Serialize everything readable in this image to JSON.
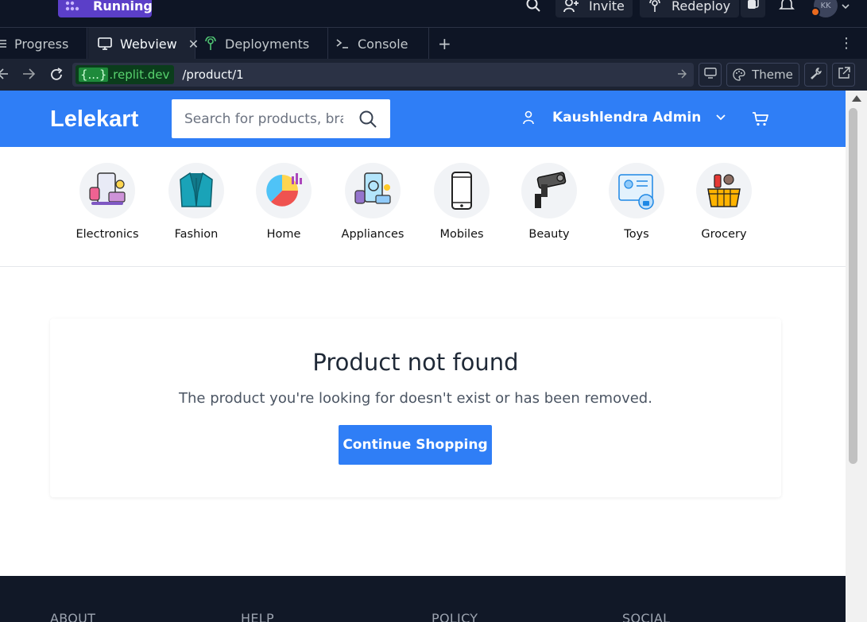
{
  "replit": {
    "run_status": "Running",
    "invite_label": "Invite",
    "redeploy_label": "Redeploy",
    "avatar_initials": "KK",
    "tabs": [
      {
        "label": "Progress"
      },
      {
        "label": "Webview"
      },
      {
        "label": "Deployments"
      },
      {
        "label": "Console"
      }
    ],
    "url": {
      "domain_brace": "{...}",
      "domain_suffix": ".replit.dev",
      "path": "/product/1"
    },
    "theme_label": "Theme"
  },
  "site": {
    "brand": "Lelekart",
    "search_placeholder": "Search for products, brands and more",
    "user_name": "Kaushlendra Admin",
    "categories": [
      {
        "label": "Electronics",
        "icon": "electronics-icon"
      },
      {
        "label": "Fashion",
        "icon": "jacket-icon"
      },
      {
        "label": "Home",
        "icon": "pie-chart-icon"
      },
      {
        "label": "Appliances",
        "icon": "appliances-icon"
      },
      {
        "label": "Mobiles",
        "icon": "mobile-phone-icon"
      },
      {
        "label": "Beauty",
        "icon": "camera-icon"
      },
      {
        "label": "Toys",
        "icon": "id-card-icon"
      },
      {
        "label": "Grocery",
        "icon": "grocery-basket-icon"
      }
    ],
    "not_found": {
      "title": "Product not found",
      "message": "The product you're looking for doesn't exist or has been removed.",
      "button": "Continue Shopping"
    },
    "footer": {
      "columns": [
        "ABOUT",
        "HELP",
        "POLICY",
        "SOCIAL"
      ]
    }
  },
  "colors": {
    "brand_blue": "#2f7ef6",
    "replit_bg": "#0e1525",
    "running_purple": "#5b3fc8"
  }
}
